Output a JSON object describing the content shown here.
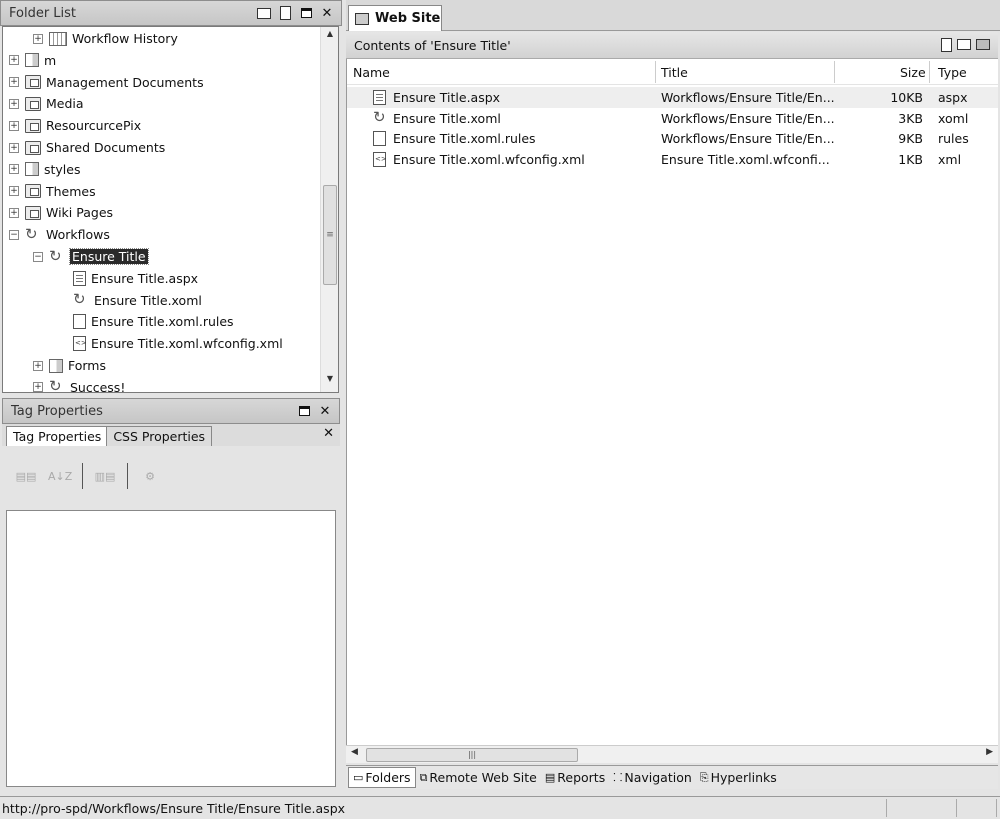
{
  "folder_list": {
    "title": "Folder List",
    "items": [
      {
        "label": "Workflow History",
        "icon": "list-icon",
        "level": 1,
        "expander": "+"
      },
      {
        "label": "m",
        "icon": "plain-folder-icon",
        "level": 0,
        "expander": "+"
      },
      {
        "label": "Management Documents",
        "icon": "library-folder-icon",
        "level": 0,
        "expander": "+"
      },
      {
        "label": "Media",
        "icon": "library-folder-icon",
        "level": 0,
        "expander": "+"
      },
      {
        "label": "ResourcurcePix",
        "icon": "library-folder-icon",
        "level": 0,
        "expander": "+"
      },
      {
        "label": "Shared Documents",
        "icon": "library-folder-icon",
        "level": 0,
        "expander": "+"
      },
      {
        "label": "styles",
        "icon": "plain-folder-icon",
        "level": 0,
        "expander": "+"
      },
      {
        "label": "Themes",
        "icon": "library-folder-icon",
        "level": 0,
        "expander": "+"
      },
      {
        "label": "Wiki Pages",
        "icon": "library-folder-icon",
        "level": 0,
        "expander": "+"
      },
      {
        "label": "Workflows",
        "icon": "workflow-folder-icon",
        "level": 0,
        "expander": "−"
      },
      {
        "label": "Ensure Title",
        "icon": "workflow-folder-icon",
        "level": 1,
        "expander": "−",
        "selected": true
      },
      {
        "label": "Ensure Title.aspx",
        "icon": "aspx-file-icon",
        "level": 2,
        "expander": ""
      },
      {
        "label": "Ensure Title.xoml",
        "icon": "xoml-file-icon",
        "level": 2,
        "expander": ""
      },
      {
        "label": "Ensure Title.xoml.rules",
        "icon": "blank-file-icon",
        "level": 2,
        "expander": ""
      },
      {
        "label": "Ensure Title.xoml.wfconfig.xml",
        "icon": "xml-file-icon",
        "level": 2,
        "expander": ""
      },
      {
        "label": "Forms",
        "icon": "plain-folder-icon",
        "level": 1,
        "expander": "+"
      },
      {
        "label": "Success!",
        "icon": "workflow-folder-icon",
        "level": 1,
        "expander": "+"
      }
    ]
  },
  "tag_properties": {
    "title": "Tag Properties",
    "tabs": [
      "Tag Properties",
      "CSS Properties"
    ],
    "tools": [
      "categorized-icon",
      "sort-az-icon",
      "show-set-properties-icon",
      "tag-properties-icon"
    ]
  },
  "web_site": {
    "tab_label": "Web Site",
    "contents_label": "Contents of 'Ensure Title'",
    "columns": {
      "name": "Name",
      "title": "Title",
      "size": "Size",
      "type": "Type"
    },
    "files": [
      {
        "name": "Ensure Title.aspx",
        "title": "Workflows/Ensure Title/En...",
        "size": "10KB",
        "type": "aspx",
        "icon": "aspx-file-icon"
      },
      {
        "name": "Ensure Title.xoml",
        "title": "Workflows/Ensure Title/En...",
        "size": "3KB",
        "type": "xoml",
        "icon": "xoml-file-icon"
      },
      {
        "name": "Ensure Title.xoml.rules",
        "title": "Workflows/Ensure Title/En...",
        "size": "9KB",
        "type": "rules",
        "icon": "blank-file-icon"
      },
      {
        "name": "Ensure Title.xoml.wfconfig.xml",
        "title": "Ensure Title.xoml.wfconfi...",
        "size": "1KB",
        "type": "xml",
        "icon": "xml-file-icon"
      }
    ],
    "views": [
      "Folders",
      "Remote Web Site",
      "Reports",
      "Navigation",
      "Hyperlinks"
    ]
  },
  "status": {
    "url": "http://pro-spd/Workflows/Ensure Title/Ensure Title.aspx"
  }
}
